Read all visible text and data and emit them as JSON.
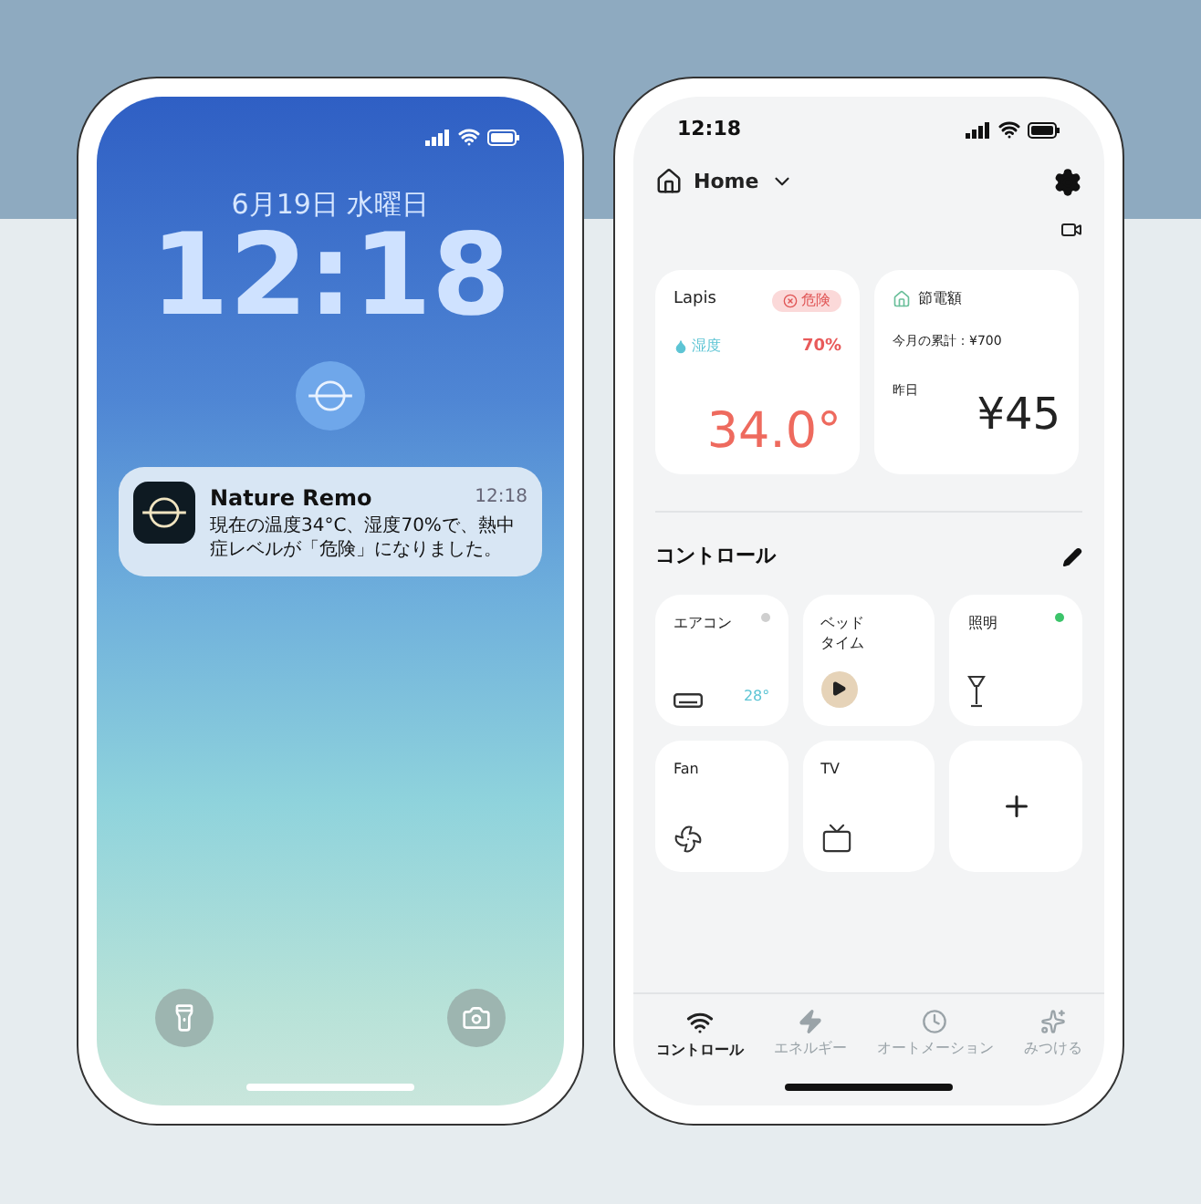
{
  "lock_screen": {
    "date": "6月19日 水曜日",
    "time": "12:18",
    "notification": {
      "app": "Nature Remo",
      "time": "12:18",
      "message": "現在の温度34°C、湿度70%で、熱中症レベルが「危険」になりました。"
    }
  },
  "app": {
    "status_time": "12:18",
    "home_label": "Home",
    "cards": [
      {
        "kind": "sensor",
        "name": "Lapis",
        "badge": "危険",
        "humidity_label": "湿度",
        "humidity": "70%",
        "temperature": "34.0°"
      },
      {
        "kind": "energy",
        "title": "節電額",
        "month_total": "今月の累計：¥700",
        "yesterday_label": "昨日",
        "yesterday": "¥45"
      }
    ],
    "controls": {
      "title": "コントロール",
      "items": [
        {
          "kind": "aircon",
          "label": "エアコン",
          "on": false,
          "reading": "28°"
        },
        {
          "kind": "bedtime",
          "label": "ベッドタイム"
        },
        {
          "kind": "light",
          "label": "照明",
          "on": true
        },
        {
          "kind": "fan",
          "label": "Fan"
        },
        {
          "kind": "tv",
          "label": "TV"
        },
        {
          "kind": "add"
        }
      ]
    },
    "tabs": [
      {
        "kind": "control",
        "label": "コントロール",
        "selected": true
      },
      {
        "kind": "energy",
        "label": "エネルギー",
        "selected": false
      },
      {
        "kind": "automation",
        "label": "オートメーション",
        "selected": false
      },
      {
        "kind": "discover",
        "label": "みつける",
        "selected": false
      }
    ]
  }
}
